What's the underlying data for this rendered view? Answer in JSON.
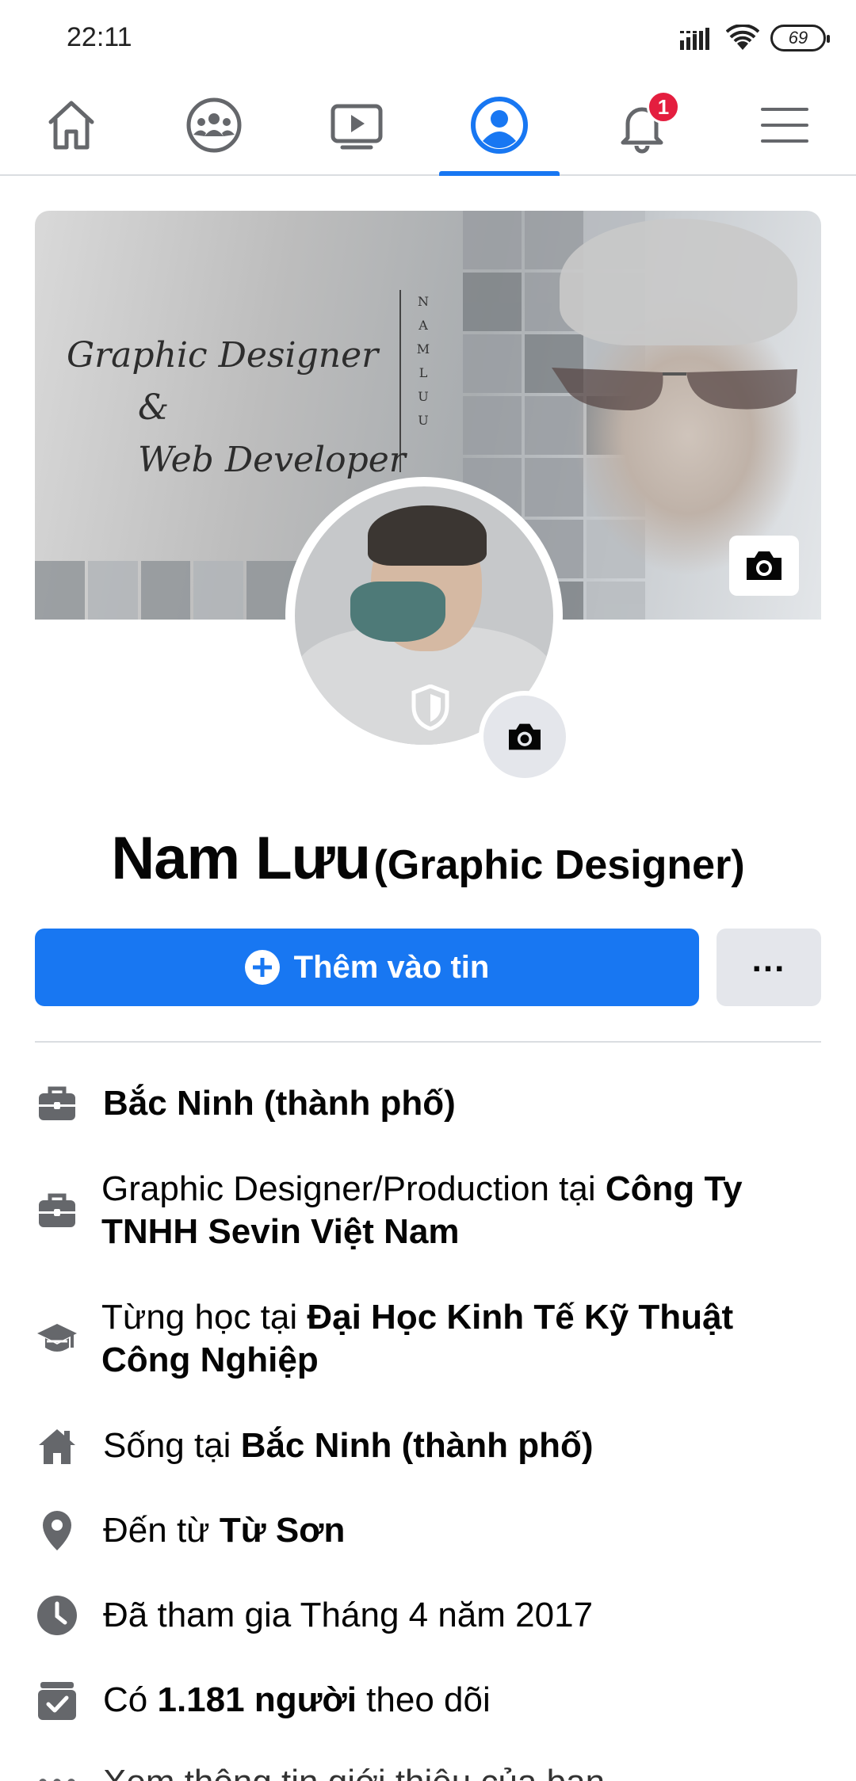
{
  "status_bar": {
    "time": "22:11",
    "battery": "69"
  },
  "nav": {
    "items": [
      {
        "name": "home"
      },
      {
        "name": "groups"
      },
      {
        "name": "watch"
      },
      {
        "name": "profile",
        "active": true
      },
      {
        "name": "notifications",
        "badge": "1"
      },
      {
        "name": "menu"
      }
    ],
    "accent": "#1877f2"
  },
  "cover": {
    "title_line1": "Graphic Designer",
    "title_amp": "&",
    "title_line2": "Web Developer",
    "vertical_text": "NAMLUU"
  },
  "profile": {
    "name": "Nam Lưu",
    "alternate_name": "(Graphic Designer)"
  },
  "actions": {
    "add_story_label": "Thêm vào tin",
    "more_label": "..."
  },
  "info": {
    "row1": {
      "bold": "Bắc Ninh (thành phố)"
    },
    "row2": {
      "prefix": "Graphic Designer/Production tại ",
      "bold": "Công Ty TNHH Sevin Việt Nam"
    },
    "row3": {
      "prefix": "Từng học tại ",
      "bold": "Đại Học Kinh Tế Kỹ Thuật Công Nghiệp"
    },
    "row4": {
      "prefix": "Sống tại ",
      "bold": "Bắc Ninh (thành phố)"
    },
    "row5": {
      "prefix": "Đến từ ",
      "bold": "Từ Sơn"
    },
    "row6": {
      "text": "Đã tham gia Tháng 4 năm 2017"
    },
    "row7": {
      "prefix": "Có ",
      "bold": "1.181 người",
      "suffix": " theo dõi"
    },
    "row8": {
      "text": "Xem thông tin giới thiệu của bạn"
    }
  },
  "colors": {
    "primary": "#1877f2",
    "badge": "#e41e3f",
    "icon_gray": "#65676b",
    "button_gray": "#e4e6eb"
  }
}
